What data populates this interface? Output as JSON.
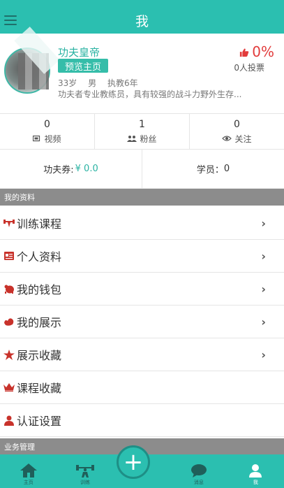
{
  "header": {
    "title": "我"
  },
  "profile": {
    "name": "功夫皇帝",
    "preview_label": "预览主页",
    "age": "33岁",
    "gender": "男",
    "experience": "执教6年",
    "bio": "功夫者专业教练员，具有较强的战斗力野外生存...",
    "vote_percent": "0%",
    "vote_count": "0人投票"
  },
  "stats": [
    {
      "value": "0",
      "label": "视频",
      "icon": "video-icon"
    },
    {
      "value": "1",
      "label": "粉丝",
      "icon": "fans-icon"
    },
    {
      "value": "0",
      "label": "关注",
      "icon": "eye-icon"
    }
  ],
  "finance": {
    "coupon_label": "功夫券:",
    "coupon_value": "¥ 0.0",
    "students_label": "学员：",
    "students_value": "0"
  },
  "sections": {
    "my_info": "我的资料",
    "business": "业务管理"
  },
  "menu": [
    {
      "label": "训练课程",
      "icon": "dumbbell-icon"
    },
    {
      "label": "个人资料",
      "icon": "id-card-icon"
    },
    {
      "label": "我的钱包",
      "icon": "wallet-icon"
    },
    {
      "label": "我的展示",
      "icon": "muscle-icon"
    },
    {
      "label": "展示收藏",
      "icon": "star-icon"
    },
    {
      "label": "课程收藏",
      "icon": "crown-icon"
    },
    {
      "label": "认证设置",
      "icon": "user-icon"
    }
  ],
  "tabs": [
    {
      "label": "主页",
      "icon": "home-icon"
    },
    {
      "label": "训练",
      "icon": "weightlifter-icon"
    },
    {
      "label": "",
      "icon": "plus-icon"
    },
    {
      "label": "消息",
      "icon": "chat-icon"
    },
    {
      "label": "我",
      "icon": "person-icon"
    }
  ],
  "colors": {
    "brand": "#2bbfb0",
    "accent_red": "#e23b3b",
    "section_gray": "#8c8c8c"
  }
}
